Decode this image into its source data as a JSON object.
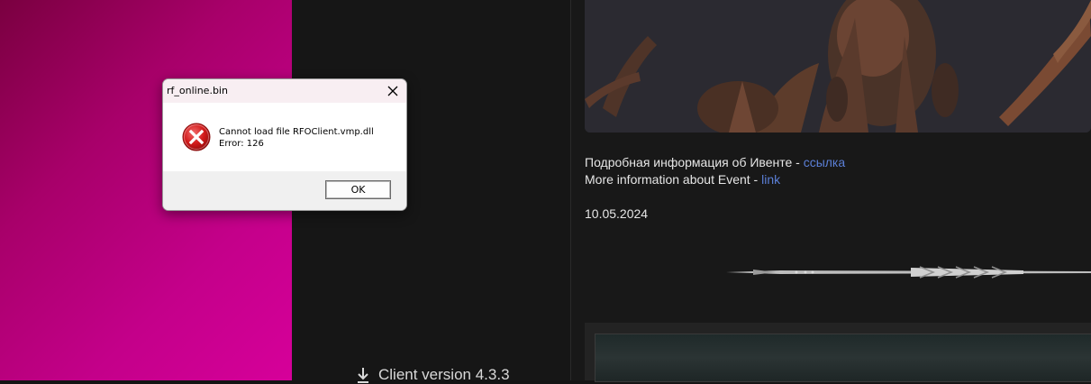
{
  "dialog": {
    "title": "rf_online.bin",
    "message_line1": "Cannot load file RFOClient.vmp.dll",
    "message_line2": "Error: 126",
    "ok_label": "OK",
    "icon": "error-icon"
  },
  "news": {
    "ru_text": "Подробная информация об Ивенте - ",
    "ru_link": "ссылка",
    "en_text": "More information about Event - ",
    "en_link": "link",
    "date": "10.05.2024"
  },
  "launcher": {
    "client_version": "Client version 4.3.3"
  },
  "colors": {
    "wallpaper": "#c4008a",
    "link": "#5b7fd6",
    "background": "#141414"
  }
}
